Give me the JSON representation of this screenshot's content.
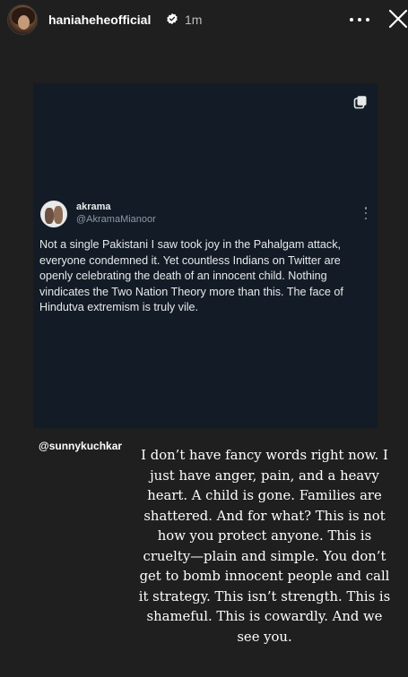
{
  "header": {
    "username": "haniaheheofficial",
    "time": "1m",
    "icons": {
      "avatar": "profile-avatar",
      "verified": "verified-badge-icon",
      "more": "more-options-icon",
      "close": "close-icon"
    }
  },
  "tweet": {
    "name": "akrama",
    "handle": "@AkramaMianoor",
    "text": "Not a single Pakistani I saw took joy in the Pahalgam attack, everyone condemned it. Yet countless Indians on Twitter are openly celebrating the death of an innocent child. Nothing vindicates the Two Nation Theory more than this. The face of Hindutva extremism is truly vile.",
    "icons": {
      "copy": "copy-icon",
      "menu": "vertical-ellipsis-icon"
    }
  },
  "mention": "@sunnykuchkar",
  "caption": "I don’t have fancy words right now. I just have anger, pain, and a heavy heart. A child is gone. Families are shattered. And for what? This is not how you protect anyone. This is cruelty—plain and simple. You don’t get to bomb innocent people and call it strategy. This isn’t strength. This is shameful. This is cowardly. And we see you.",
  "colors": {
    "background": "#1f1f1f",
    "card": "#131c26",
    "handle": "#8b98a5",
    "verified": "#ffffff"
  }
}
